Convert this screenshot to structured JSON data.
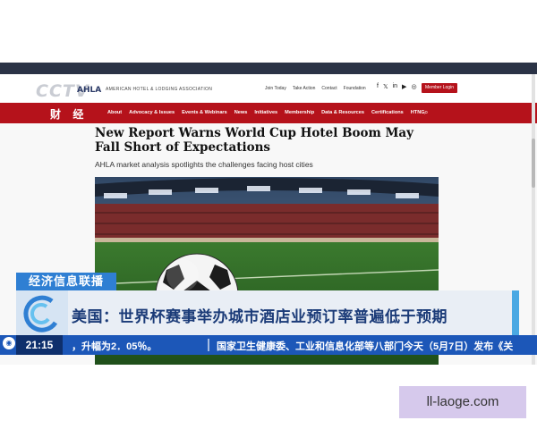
{
  "tv": {
    "logo": "CCTV",
    "channel_label": "财 经",
    "program_tag": "经济信息联播",
    "caption": "美国：世界杯赛事举办城市酒店业预订率普遍低于预期",
    "clock": "21:15",
    "ticker_left": "，升幅为2．05％。",
    "ticker_right": "国家卫生健康委、工业和信息化部等八部门今天（5月7日）发布《关"
  },
  "site": {
    "logo": "AHLA",
    "org_name": "AMERICAN HOTEL & LODGING ASSOCIATION",
    "utility_links": [
      "Join Today",
      "Take Action",
      "Contact",
      "Foundation"
    ],
    "social_icons": [
      "facebook-icon",
      "x-icon",
      "linkedin-icon",
      "youtube-icon",
      "instagram-icon"
    ],
    "member_login": "Member Login",
    "nav": [
      "About",
      "Advocacy & Issues",
      "Events & Webinars",
      "News",
      "Initiatives",
      "Membership",
      "Data & Resources",
      "Certifications",
      "HTNG"
    ],
    "accent": "#b5121b"
  },
  "article": {
    "headline": "New Report Warns World Cup Hotel Boom May Fall Short of Expectations",
    "subheadline": "AHLA market analysis spotlights the challenges facing host cities"
  },
  "watermark": "ll-laoge.com"
}
